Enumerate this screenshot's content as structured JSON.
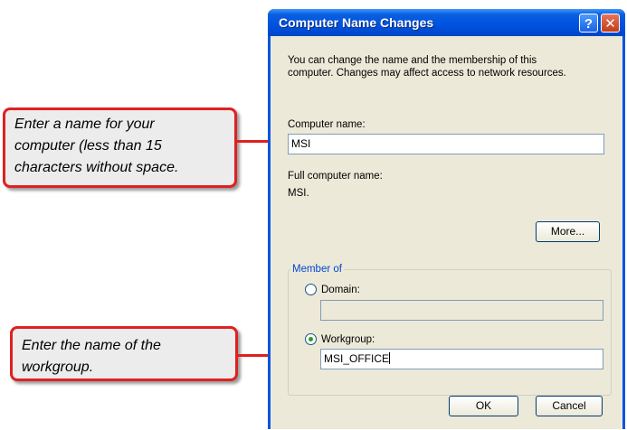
{
  "dialog": {
    "title": "Computer Name Changes",
    "help_glyph": "?",
    "close_glyph": "✕",
    "description_line1": "You can change the name and the membership of this",
    "description_line2": "computer. Changes may affect access to network resources.",
    "computer_name_label": "Computer name:",
    "computer_name_value": "MSI",
    "full_name_label": "Full computer name:",
    "full_name_value": "MSI.",
    "more_button": "More...",
    "member_of_legend": "Member of",
    "domain_label": "Domain:",
    "domain_value": "",
    "domain_selected": false,
    "workgroup_label": "Workgroup:",
    "workgroup_value": "MSI_OFFICE",
    "workgroup_selected": true,
    "ok_button": "OK",
    "cancel_button": "Cancel"
  },
  "callouts": {
    "name_line1": "Enter a name for your",
    "name_line2": "computer (less than 15",
    "name_line3": "characters without space.",
    "workgroup_line1": "Enter the name of the",
    "workgroup_line2": "workgroup."
  },
  "colors": {
    "title_bar": "#0054e3",
    "callout_border": "#e02020",
    "group_legend": "#0046d5"
  }
}
